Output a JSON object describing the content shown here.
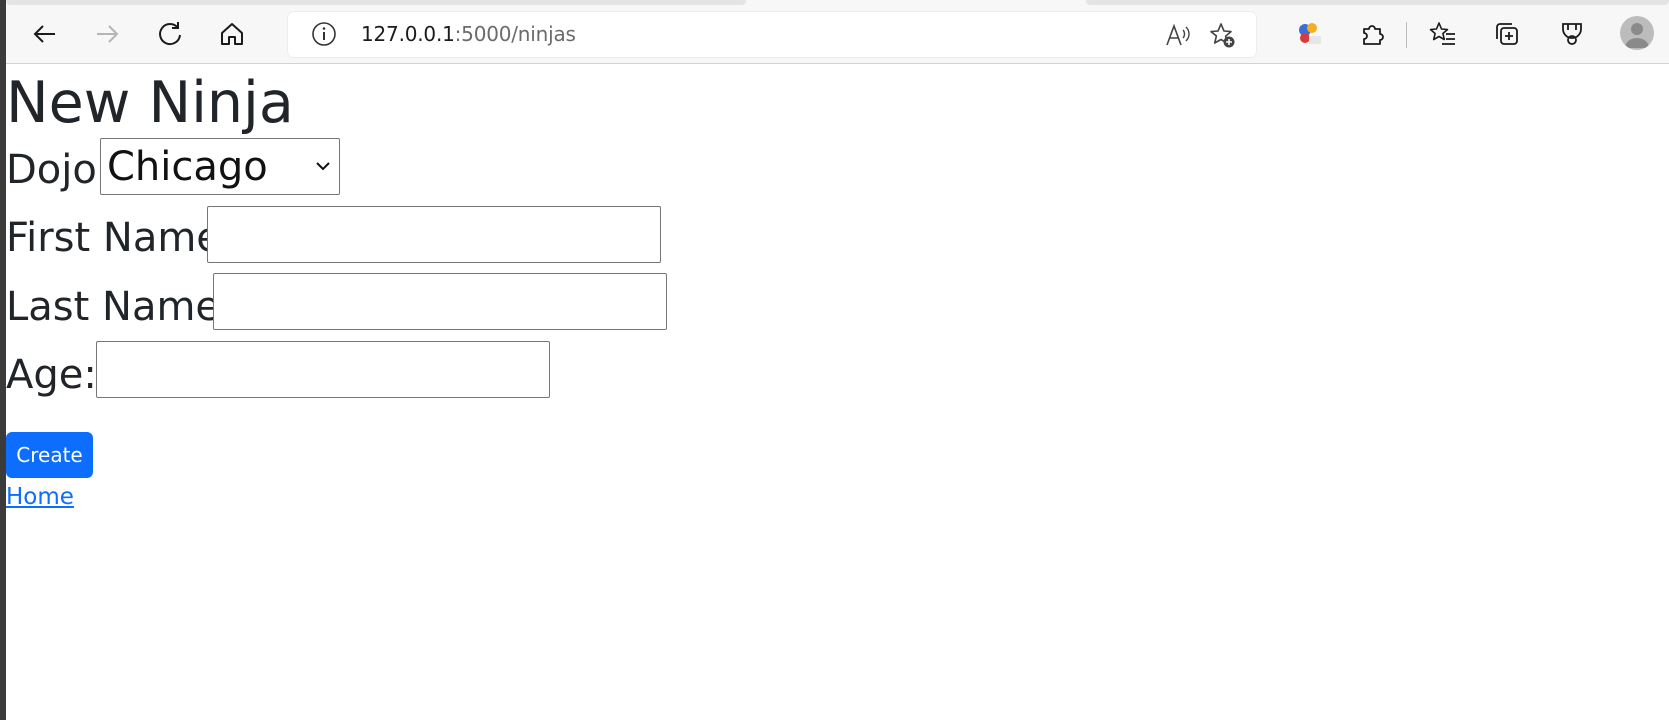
{
  "browser": {
    "url_host": "127.0.0.1",
    "url_path": ":5000/ninjas",
    "icons": [
      "back-icon",
      "forward-icon",
      "refresh-icon",
      "home-icon",
      "site-info-icon",
      "read-aloud-icon",
      "add-favorite-icon",
      "extension-app-icon",
      "extensions-icon",
      "favorites-icon",
      "collections-icon",
      "performance-icon",
      "profile-avatar"
    ]
  },
  "page": {
    "title": "New Ninja",
    "dojo_label": "Dojo:",
    "dojo_value": "Chicago",
    "first_name_label": "First Name:",
    "first_name_value": "",
    "last_name_label": "Last Name:",
    "last_name_value": "",
    "age_label": "Age:",
    "age_value": "",
    "create_label": "Create",
    "home_link": "Home"
  },
  "colors": {
    "primary": "#0d6efd",
    "text": "#212529",
    "toolbar_bg": "#f7f7f7"
  }
}
